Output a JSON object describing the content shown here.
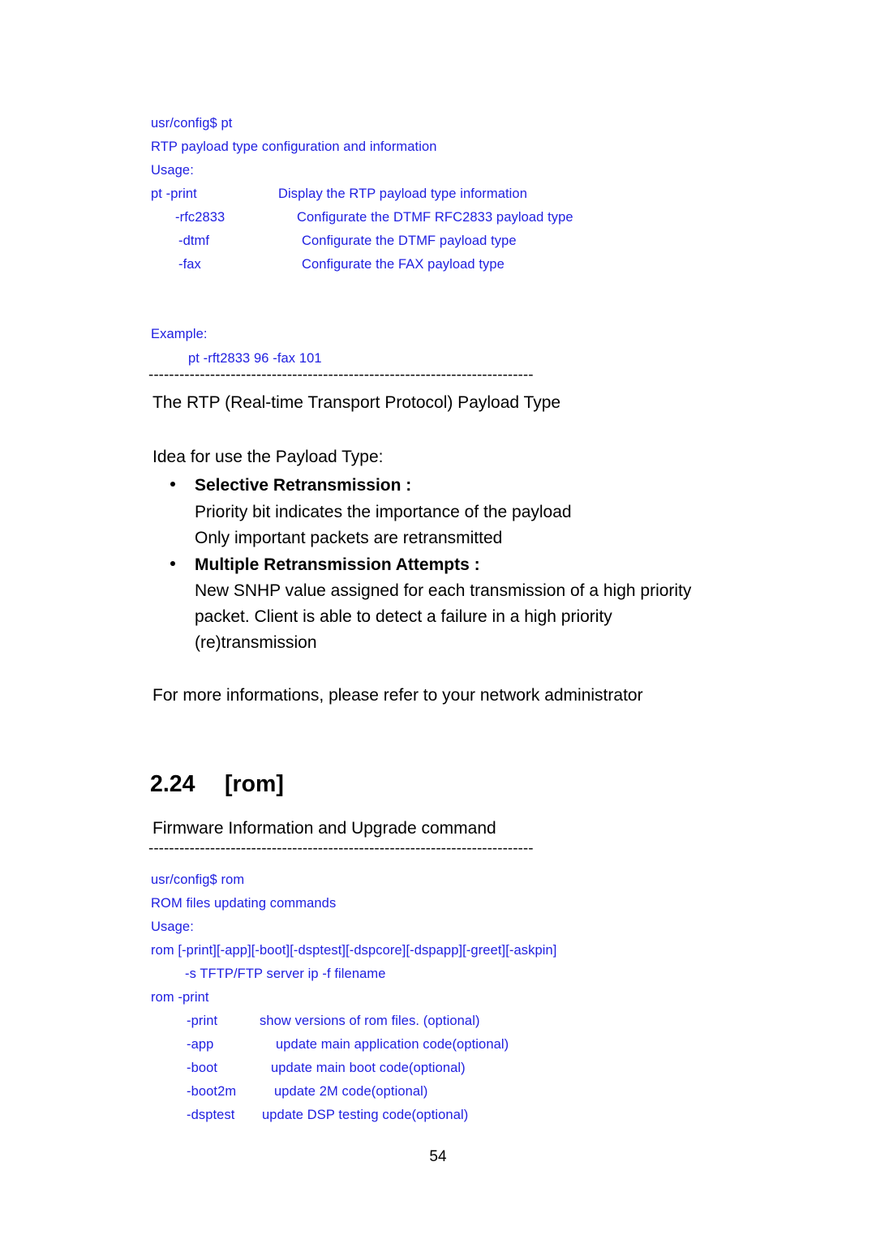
{
  "page": {
    "number": "54",
    "separator_glyph": "-"
  },
  "pt_block": {
    "prompt": "usr/config$ pt",
    "description": "RTP payload type configuration and information",
    "usage_label": "Usage:",
    "options": [
      {
        "opt": "pt -print",
        "desc": "Display the RTP payload type information"
      },
      {
        "opt": "-rfc2833",
        "desc": "Configurate the DTMF RFC2833 payload type"
      },
      {
        "opt": "-dtmf",
        "desc": "Configurate the DTMF payload type"
      },
      {
        "opt": "-fax",
        "desc": "Configurate the FAX payload type"
      }
    ],
    "example_label": "Example:",
    "example_cmd": "pt -rft2833 96 -fax 101"
  },
  "rtp_section": {
    "title": "The RTP (Real-time Transport Protocol) Payload Type",
    "idea_label": "Idea for use the Payload Type:",
    "bullets": [
      {
        "heading": "Selective Retransmission :",
        "lines": [
          "Priority bit indicates the importance of the payload",
          "Only important packets are retransmitted"
        ]
      },
      {
        "heading": "Multiple Retransmission Attempts :",
        "lines": [
          "New SNHP value assigned for each transmission of a high priority",
          "packet. Client is able to detect a failure in a high priority",
          "(re)transmission"
        ]
      }
    ],
    "footer_note": "For more informations, please refer to your network administrator"
  },
  "rom_section": {
    "number": "2.24",
    "title": "[rom]",
    "subtitle": "Firmware Information and Upgrade command",
    "prompt": "usr/config$ rom",
    "description": "ROM files updating commands",
    "usage_label": "Usage:",
    "usage_syntax": "rom [-print][-app][-boot][-dsptest][-dspcore][-dspapp][-greet][-askpin]",
    "usage_syntax_cont": "-s TFTP/FTP server ip -f filename",
    "usage_example": "rom -print",
    "options": [
      {
        "opt": "-print",
        "desc": "show versions of rom files. (optional)"
      },
      {
        "opt": "-app",
        "desc": "update main application code(optional)"
      },
      {
        "opt": "-boot",
        "desc": "update main boot code(optional)"
      },
      {
        "opt": "-boot2m",
        "desc": "update 2M code(optional)"
      },
      {
        "opt": "-dsptest",
        "desc": "update DSP testing code(optional)"
      }
    ]
  }
}
